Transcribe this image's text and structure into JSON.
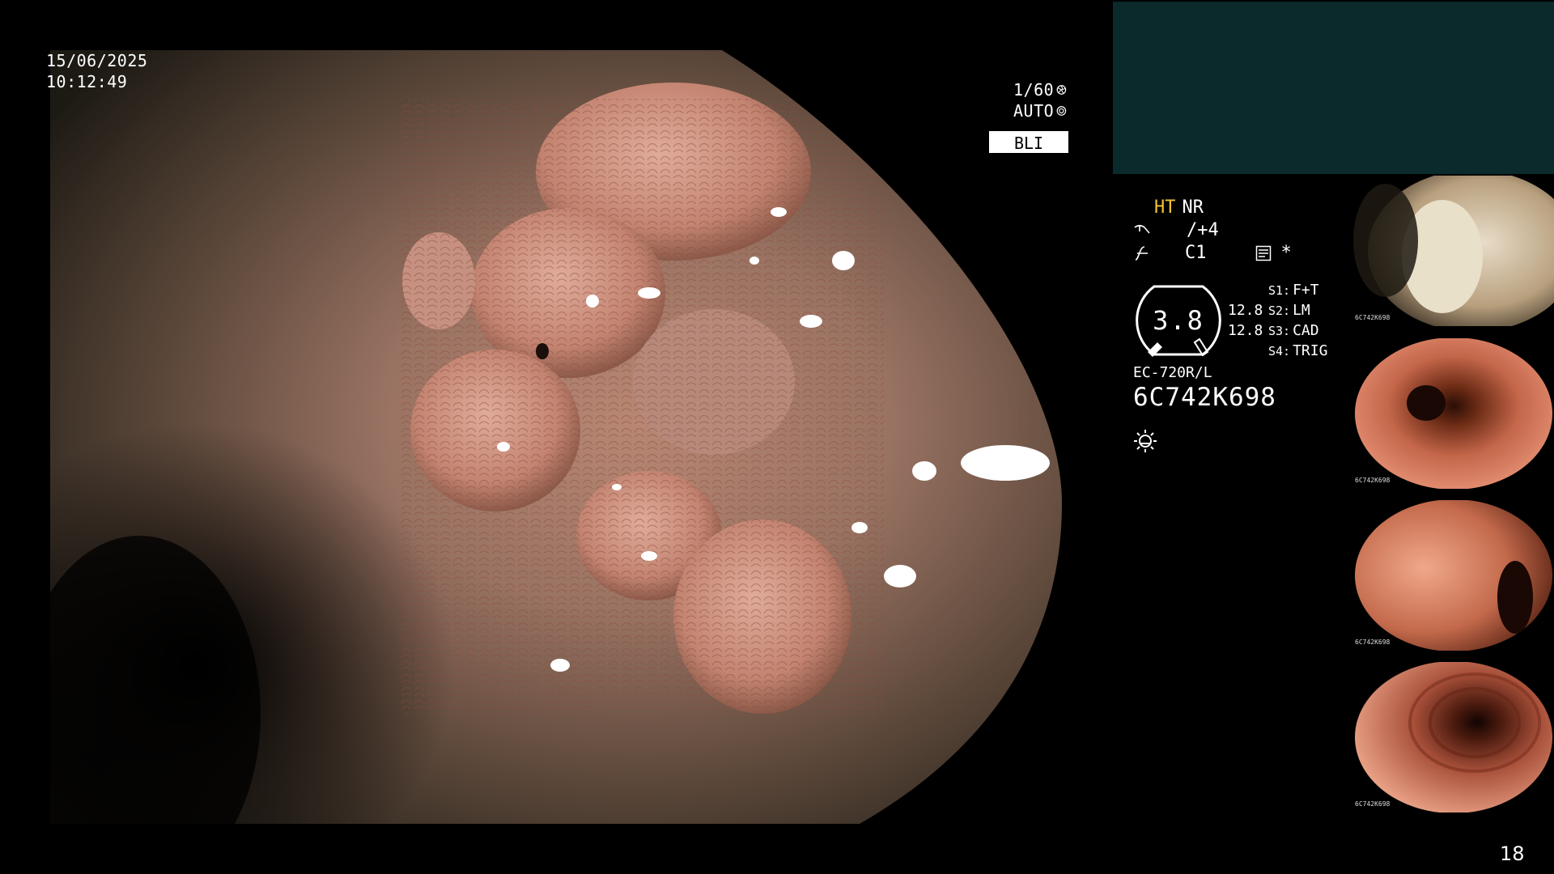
{
  "datetime": {
    "date": "15/06/2025",
    "time": "10:12:49"
  },
  "exposure": {
    "shutter": "1/60",
    "mode": "AUTO",
    "imaging_mode": "BLI"
  },
  "status": {
    "ht": "HT",
    "nr": "NR",
    "enhance": "/+4",
    "color": "C1",
    "star": "*",
    "iris_value": "3.8",
    "readout1": "12.8",
    "readout2": "12.8",
    "switches": [
      {
        "label": "S1:",
        "value": "F+T"
      },
      {
        "label": "S2:",
        "value": "LM"
      },
      {
        "label": "S3:",
        "value": "CAD"
      },
      {
        "label": "S4:",
        "value": "TRIG"
      }
    ],
    "scope_model": "EC-720R/L",
    "scope_serial": "6C742K698"
  },
  "thumbnails": [
    {
      "caption": "6C742K698"
    },
    {
      "caption": "6C742K698"
    },
    {
      "caption": "6C742K698"
    },
    {
      "caption": "6C742K698"
    }
  ],
  "page_number": "18",
  "colors": {
    "ht_accent": "#f4c431",
    "panel_teal": "#0a2a2b"
  },
  "icons": [
    "shutter-icon",
    "auto-iris-icon",
    "enhance-icon",
    "color-mode-icon",
    "memo-icon",
    "brightness-icon"
  ]
}
